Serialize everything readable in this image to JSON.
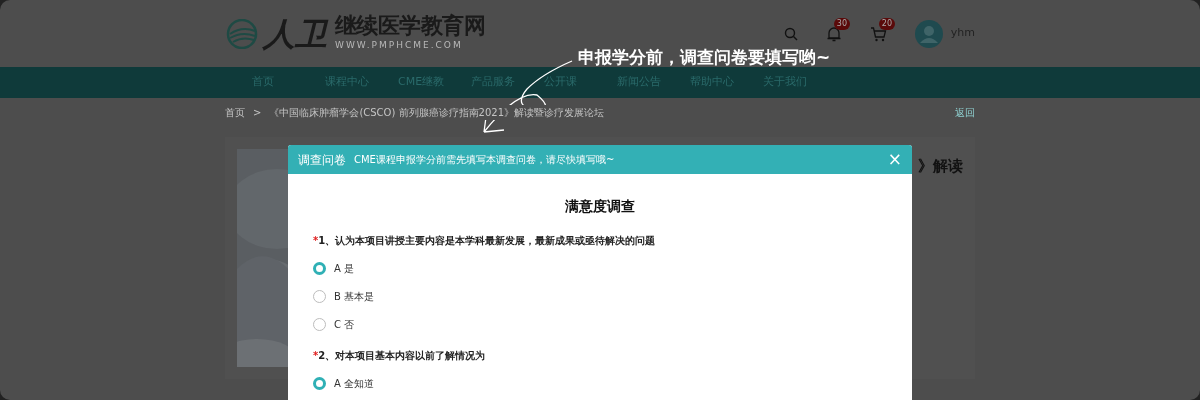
{
  "header": {
    "logo_mark": "人卫",
    "logo_name": "继续医学教育网",
    "logo_url": "WWW.PMPHCME.COM",
    "notifications_badge": "30",
    "cart_badge": "20",
    "username": "yhm"
  },
  "nav": [
    {
      "label": "首页"
    },
    {
      "label": "课程中心"
    },
    {
      "label": "CME继教"
    },
    {
      "label": "产品服务"
    },
    {
      "label": "公开课"
    },
    {
      "label": "新闻公告"
    },
    {
      "label": "帮助中心"
    },
    {
      "label": "关于我们"
    }
  ],
  "breadcrumb": {
    "home": "首页",
    "separator": ">",
    "current": "《中国临床肿瘤学会(CSCO) 前列腺癌诊疗指南2021》解读暨诊疗发展论坛",
    "back": "返回"
  },
  "course_title_visible": "》解读",
  "annotation": "申报学分前，调查问卷要填写哟~",
  "dialog": {
    "title": "调查问卷",
    "subtitle": "CME课程申报学分前需先填写本调查问卷，请尽快填写哦~",
    "close": "×",
    "heading": "满意度调查",
    "questions": [
      {
        "required_mark": "*",
        "text": "1、认为本项目讲授主要内容是本学科最新发展，最新成果或亟待解决的问题",
        "options": [
          {
            "label": "A 是",
            "selected": true
          },
          {
            "label": "B 基本是",
            "selected": false
          },
          {
            "label": "C 否",
            "selected": false
          }
        ]
      },
      {
        "required_mark": "*",
        "text": "2、对本项目基本内容以前了解情况为",
        "options": [
          {
            "label": "A 全知道",
            "selected": true
          }
        ]
      }
    ]
  }
}
